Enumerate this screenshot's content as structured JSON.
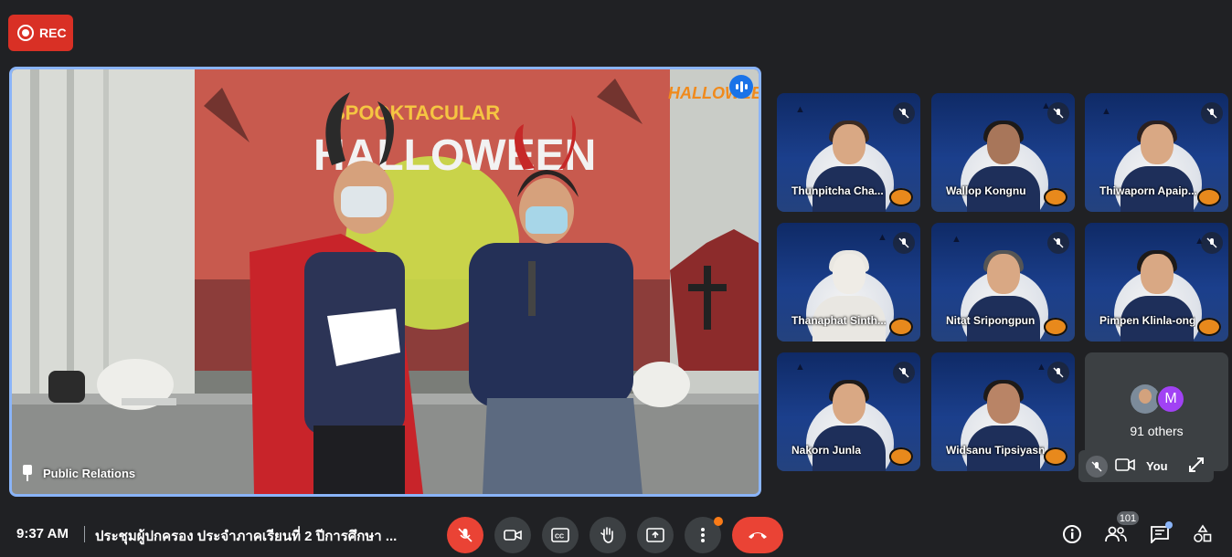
{
  "recording": {
    "label": "REC",
    "color": "#d93025"
  },
  "main": {
    "presenter_name": "Public Relations",
    "screen_title_top": "SPOOKTACULAR",
    "screen_title_main": "HALLOWEEN",
    "screen_brand": "HALLOWEEN"
  },
  "participants": [
    {
      "name": "Thunpitcha Cha...",
      "muted": true
    },
    {
      "name": "Wallop Kongnu",
      "muted": true
    },
    {
      "name": "Thiwaporn Apaip...",
      "muted": true
    },
    {
      "name": "Thanaphat Sinth...",
      "muted": true
    },
    {
      "name": "Nitat Sripongpun",
      "muted": true
    },
    {
      "name": "Pimpen Klinla-ong",
      "muted": true
    },
    {
      "name": "Nakorn Junla",
      "muted": true
    },
    {
      "name": "Widsanu Tipsiyasn",
      "muted": true
    }
  ],
  "others": {
    "avatar_letter": "M",
    "label": "91 others"
  },
  "self": {
    "label": "You"
  },
  "bottom_bar": {
    "time": "9:37 AM",
    "meeting_title": "ประชุมผู้ปกครอง ประจำภาคเรียนที่ 2 ปีการศึกษา ...",
    "people_count": "101",
    "icons": [
      "mic-off-icon",
      "camera-icon",
      "captions-icon",
      "raise-hand-icon",
      "present-icon",
      "more-icon",
      "end-call-icon",
      "info-icon",
      "people-icon",
      "chat-icon",
      "activities-icon"
    ]
  }
}
